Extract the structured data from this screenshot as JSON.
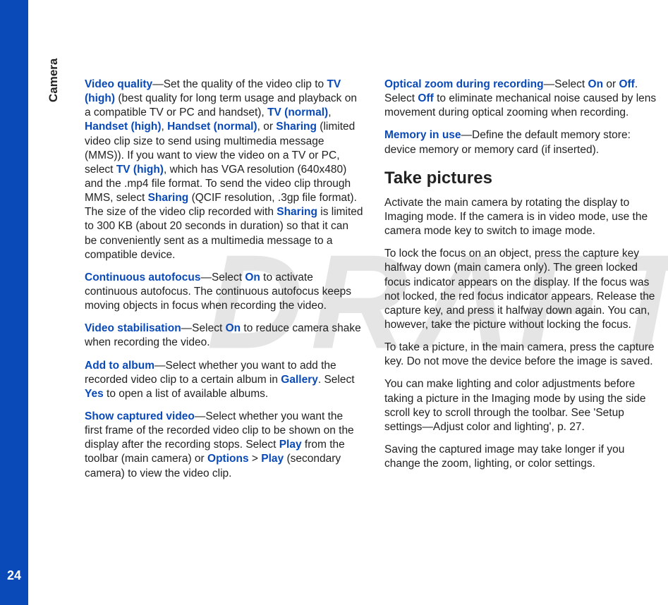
{
  "sidebar": {
    "section_label": "Camera",
    "page_number": "24"
  },
  "watermark": "DRAFT",
  "paragraphs": {
    "video_quality": {
      "t1": "Video quality",
      "t2": "—Set the quality of the video clip to ",
      "t3": "TV (high)",
      "t4": " (best quality for long term usage and playback on a compatible TV or PC and handset), ",
      "t5": "TV (normal)",
      "t6": ", ",
      "t7": "Handset (high)",
      "t8": ", ",
      "t9": "Handset (normal)",
      "t10": ", or ",
      "t11": "Sharing",
      "t12": " (limited video clip size to send using multimedia message (MMS)). If you want to view the video on a TV or PC, select ",
      "t13": "TV (high)",
      "t14": ", which has VGA resolution (640x480) and the .mp4 file format. To send the video clip through MMS, select ",
      "t15": "Sharing",
      "t16": " (QCIF resolution, .3gp file format). The size of the video clip recorded with ",
      "t17": "Sharing",
      "t18": " is limited to 300 KB (about 20 seconds in duration) so that it can be conveniently sent as a multimedia message to a compatible device."
    },
    "continuous_af": {
      "t1": "Continuous autofocus",
      "t2": "—Select ",
      "t3": "On",
      "t4": " to activate continuous autofocus. The continuous autofocus keeps moving objects in focus when recording the video."
    },
    "video_stab": {
      "t1": "Video stabilisation",
      "t2": "—Select ",
      "t3": "On",
      "t4": " to reduce camera shake when recording the video."
    },
    "add_album": {
      "t1": "Add to album",
      "t2": "—Select whether you want to add the recorded video clip to a certain album in ",
      "t3": "Gallery",
      "t4": ". Select ",
      "t5": "Yes",
      "t6": " to open a list of available albums."
    },
    "show_captured": {
      "t1": "Show captured video",
      "t2": "—Select whether you want the first frame of the recorded video clip to be shown on the display after the recording stops. Select ",
      "t3": "Play",
      "t4": " from the toolbar (main camera) or ",
      "t5": "Options",
      "t6": " > ",
      "t7": "Play",
      "t8": " (secondary camera) to view the video clip."
    },
    "optical_zoom": {
      "t1": "Optical zoom during recording",
      "t2": "—Select ",
      "t3": "On",
      "t4": " or ",
      "t5": "Off",
      "t6": ". Select ",
      "t7": "Off",
      "t8": " to eliminate mechanical noise caused by lens movement during optical zooming when recording."
    },
    "memory_in_use": {
      "t1": "Memory in use",
      "t2": "—Define the default memory store: device memory or memory card (if inserted)."
    },
    "heading": "Take pictures",
    "tp1": "Activate the main camera by rotating the display to Imaging mode. If the camera is in video mode, use the camera mode key to switch to image mode.",
    "tp2": "To lock the focus on an object, press the capture key halfway down (main camera only). The green locked focus indicator appears on the display. If the focus was not locked, the red focus indicator appears. Release the capture key, and press it halfway down again. You can, however, take the picture without locking the focus.",
    "tp3": "To take a picture, in the main camera, press the capture key. Do not move the device before the image is saved.",
    "tp4": "You can make lighting and color adjustments before taking a picture in the Imaging mode by using the side scroll key to scroll through the toolbar. See 'Setup settings—Adjust color and lighting', p. 27.",
    "tp5": "Saving the captured image may take longer if you change the zoom, lighting, or color settings."
  }
}
